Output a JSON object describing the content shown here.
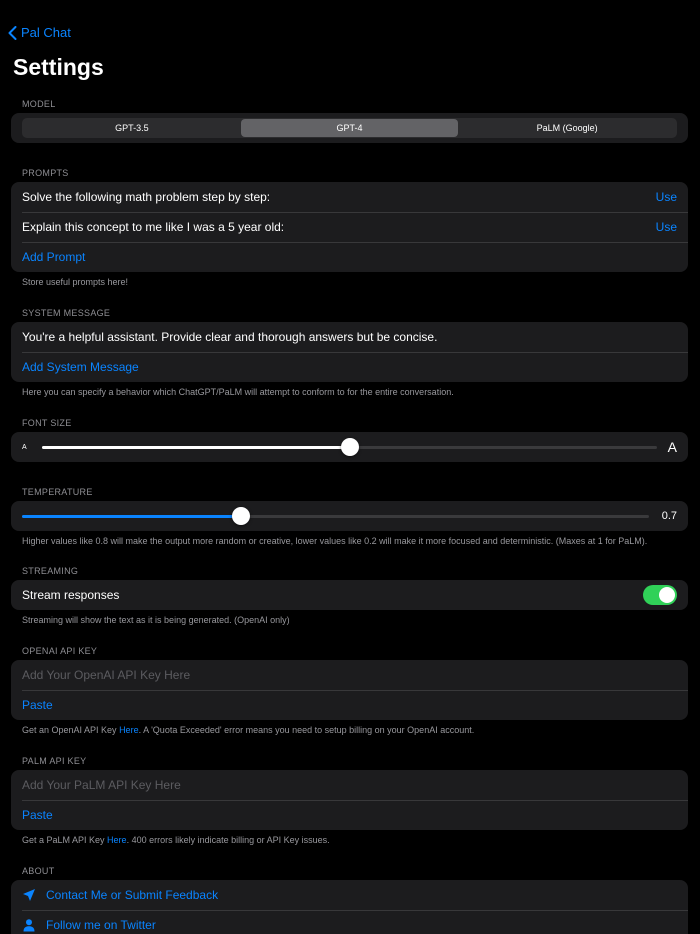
{
  "nav": {
    "back_label": "Pal Chat"
  },
  "page_title": "Settings",
  "model": {
    "label": "MODEL",
    "options": [
      "GPT-3.5",
      "GPT-4",
      "PaLM (Google)"
    ],
    "selected": "GPT-4"
  },
  "prompts": {
    "label": "PROMPTS",
    "items": [
      {
        "text": "Solve the following math problem step by step:",
        "action": "Use"
      },
      {
        "text": "Explain this concept to me like I was a 5 year old:",
        "action": "Use"
      }
    ],
    "add_label": "Add Prompt",
    "footer": "Store useful prompts here!"
  },
  "system_message": {
    "label": "SYSTEM MESSAGE",
    "text": "You're a helpful assistant. Provide clear and thorough answers but be concise.",
    "add_label": "Add System Message",
    "footer": "Here you can specify a behavior which ChatGPT/PaLM will attempt to conform to for the entire conversation."
  },
  "font_size": {
    "label": "FONT SIZE",
    "small_glyph": "A",
    "large_glyph": "A",
    "level": 0.5
  },
  "temperature": {
    "label": "TEMPERATURE",
    "value": "0.7",
    "level": 0.35,
    "footer": "Higher values like 0.8 will make the output more random or creative, lower values like 0.2 will make it more focused and deterministic. (Maxes at 1 for PaLM)."
  },
  "streaming": {
    "label": "STREAMING",
    "toggle_label": "Stream responses",
    "enabled": true,
    "footer": "Streaming will show the text as it is being generated. (OpenAI only)"
  },
  "openai": {
    "label": "OPENAI API KEY",
    "placeholder": "Add Your OpenAI API Key Here",
    "paste_label": "Paste",
    "footer_pre": "Get an OpenAI API Key ",
    "footer_link": "Here",
    "footer_post": ". A 'Quota Exceeded' error means you need to setup billing on your OpenAI account."
  },
  "palm": {
    "label": "PALM API KEY",
    "placeholder": "Add Your PaLM API Key Here",
    "paste_label": "Paste",
    "footer_pre": "Get a PaLM API Key ",
    "footer_link": "Here",
    "footer_post": ". 400 errors likely indicate billing or API Key issues."
  },
  "about": {
    "label": "ABOUT",
    "items": [
      {
        "icon": "paper-plane-icon",
        "text": "Contact Me or Submit Feedback"
      },
      {
        "icon": "person-icon",
        "text": "Follow me on Twitter"
      }
    ]
  },
  "colors": {
    "accent": "#0a84ff",
    "toggle_on": "#30d158",
    "background": "#000000",
    "group_background": "#1c1c1e"
  }
}
